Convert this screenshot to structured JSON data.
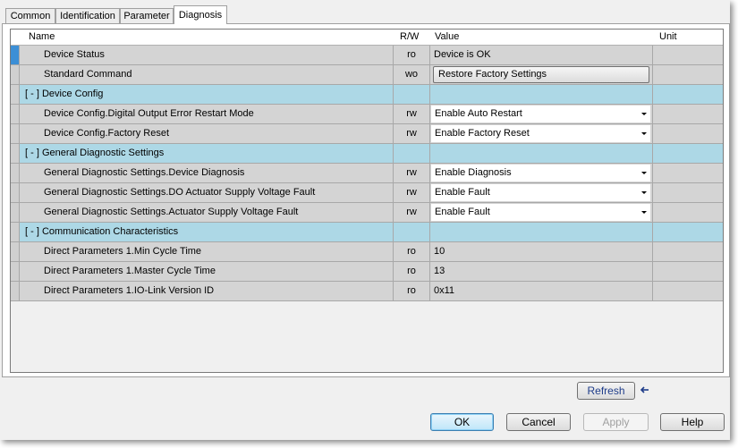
{
  "tabs": [
    {
      "label": "Common"
    },
    {
      "label": "Identification"
    },
    {
      "label": "Parameter"
    },
    {
      "label": "Diagnosis"
    }
  ],
  "columns": {
    "name": "Name",
    "rw": "R/W",
    "value": "Value",
    "unit": "Unit"
  },
  "rows": [
    {
      "name": "Device Status",
      "rw": "ro",
      "value": "Device is OK",
      "unit": ""
    },
    {
      "name": "Standard Command",
      "rw": "wo",
      "value": "Restore Factory Settings",
      "unit": ""
    },
    {
      "name": "[ - ]  Device Config"
    },
    {
      "name": "Device Config.Digital Output Error Restart Mode",
      "rw": "rw",
      "value": "Enable Auto Restart",
      "unit": ""
    },
    {
      "name": "Device Config.Factory Reset",
      "rw": "rw",
      "value": "Enable Factory Reset",
      "unit": ""
    },
    {
      "name": "[ - ]  General Diagnostic Settings"
    },
    {
      "name": "General Diagnostic Settings.Device Diagnosis",
      "rw": "rw",
      "value": "Enable Diagnosis",
      "unit": ""
    },
    {
      "name": "General Diagnostic Settings.DO Actuator Supply Voltage Fault",
      "rw": "rw",
      "value": "Enable Fault",
      "unit": ""
    },
    {
      "name": "General Diagnostic Settings.Actuator Supply Voltage Fault",
      "rw": "rw",
      "value": "Enable Fault",
      "unit": ""
    },
    {
      "name": "[ - ]  Communication Characteristics"
    },
    {
      "name": "Direct Parameters 1.Min Cycle Time",
      "rw": "ro",
      "value": "10",
      "unit": ""
    },
    {
      "name": "Direct Parameters 1.Master Cycle Time",
      "rw": "ro",
      "value": "13",
      "unit": ""
    },
    {
      "name": "Direct Parameters 1.IO-Link Version ID",
      "rw": "ro",
      "value": "0x11",
      "unit": ""
    }
  ],
  "buttons": {
    "refresh": "Refresh",
    "ok": "OK",
    "cancel": "Cancel",
    "apply": "Apply",
    "help": "Help"
  },
  "colors": {
    "group_row": "#add8e6",
    "data_row": "#d4d4d4",
    "current_row_marker": "#3c8fd6",
    "refresh_arrow": "#1f3d8a"
  },
  "icons": {
    "dropdown": "chevron-down-icon",
    "refresh_indicator": "arrow-left-icon"
  }
}
